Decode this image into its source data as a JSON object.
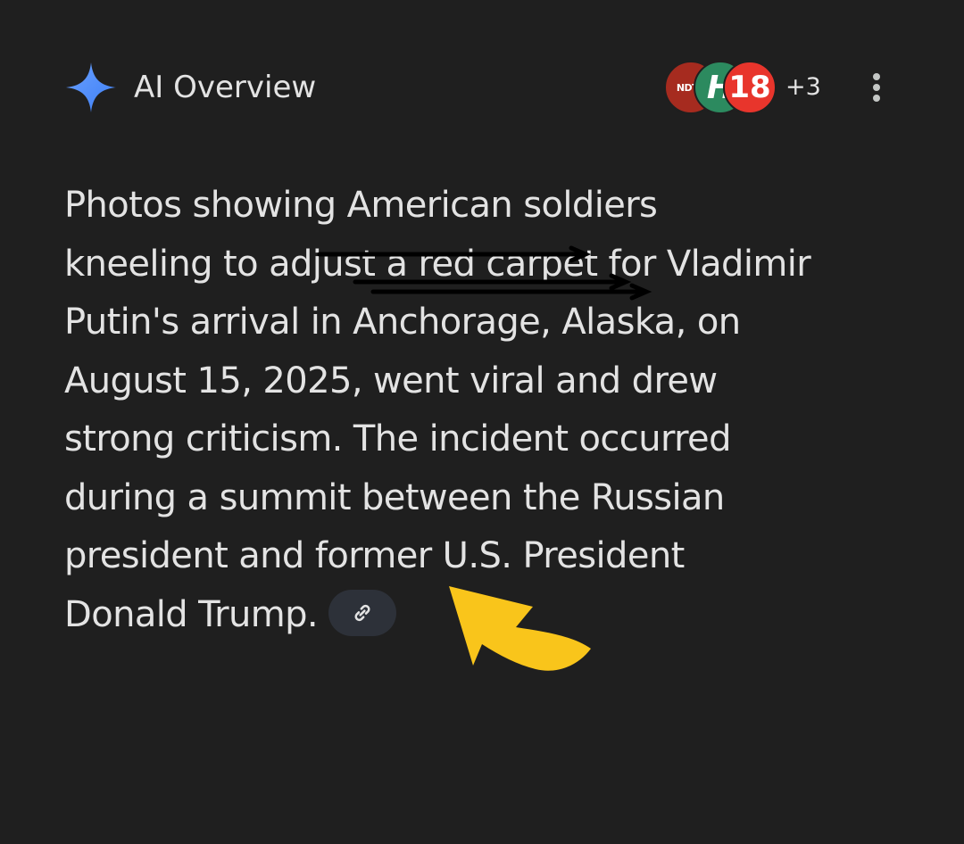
{
  "header": {
    "title": "AI Overview",
    "sparkle_icon": "sparkle-icon",
    "sparkle_colors": [
      "#4e8cf7",
      "#8ab4f8"
    ],
    "sources": [
      {
        "label": "NDTV",
        "color": "#a62b1f"
      },
      {
        "label": "H",
        "color": "#2c8a5f"
      },
      {
        "label": "18",
        "color": "#e8352c"
      }
    ],
    "more_sources": "+3",
    "menu_icon": "more-vert-icon"
  },
  "overview": {
    "lines": [
      "Photos showing American soldiers",
      "kneeling to adjust a red carpet for Vladimir",
      "Putin's arrival in Anchorage, Alaska, on",
      "August 15, 2025, went viral and drew",
      "strong criticism. The incident occurred",
      "during a summit between the Russian",
      "president and former U.S. President",
      "Donald Trump."
    ],
    "link_icon": "link-icon"
  },
  "annotations": {
    "arrow_color": "#f9c51b",
    "strike_color": "#000000"
  }
}
